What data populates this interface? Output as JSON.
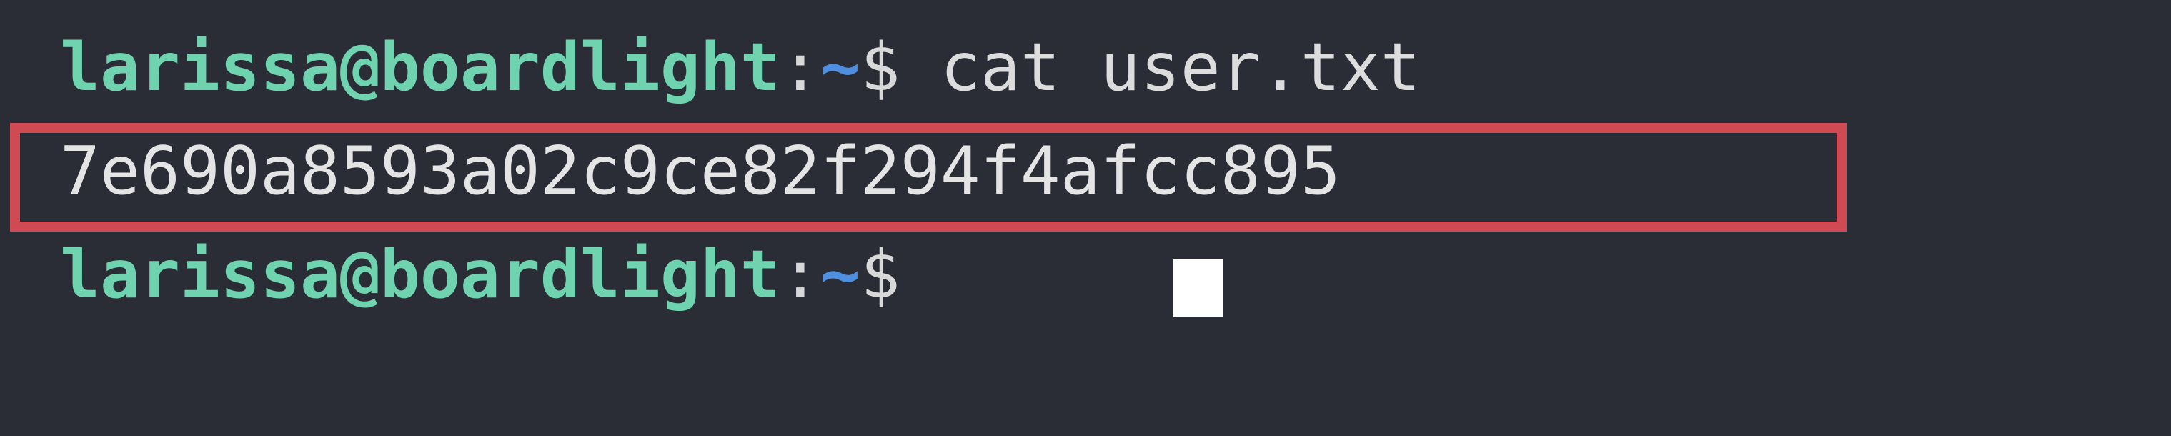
{
  "terminal": {
    "prompt": {
      "user_host": "larissa@boardlight",
      "colon": ":",
      "path": "~",
      "dollar": "$"
    },
    "command_line": {
      "command": " cat user.txt"
    },
    "output_line": {
      "text": "7e690a8593a02c9ce82f294f4afcc895"
    },
    "colors": {
      "background": "#2a2d36",
      "user_host": "#6fd3b0",
      "path": "#4f8fe0",
      "highlight": "#cf4a52",
      "cursor": "#ffffff"
    }
  }
}
